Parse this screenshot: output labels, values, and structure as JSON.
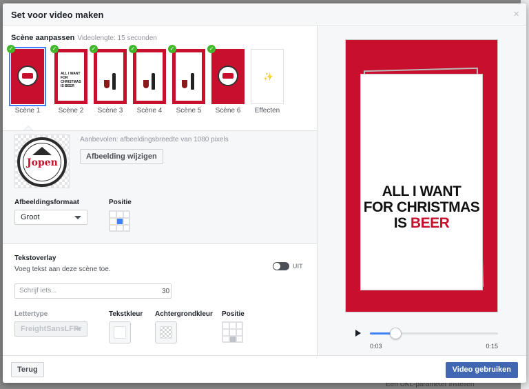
{
  "background": {
    "footer_text": "Een UKL-parameter instellen"
  },
  "dialog": {
    "title": "Set voor video maken",
    "close_glyph": "×"
  },
  "scenes_header": {
    "title": "Scène aanpassen",
    "length_label": "Videolengte: 15 seconden"
  },
  "scenes": [
    {
      "label": "Scène 1",
      "selected": true,
      "checked": true,
      "art": "logo"
    },
    {
      "label": "Scène 2",
      "selected": false,
      "checked": true,
      "art": "text",
      "mini_text": "ALL I WANT FOR CHRISTMAS IS BEER"
    },
    {
      "label": "Scène 3",
      "selected": false,
      "checked": true,
      "art": "glass-bottle"
    },
    {
      "label": "Scène 4",
      "selected": false,
      "checked": true,
      "art": "glass-bottle"
    },
    {
      "label": "Scène 5",
      "selected": false,
      "checked": true,
      "art": "glass-bottle"
    },
    {
      "label": "Scène 6",
      "selected": false,
      "checked": true,
      "art": "logo-red"
    }
  ],
  "effects": {
    "label": "Effecten",
    "icon": "sparkle-icon"
  },
  "image_section": {
    "recommendation": "Aanbevolen: afbeeldingsbreedte van 1080 pixels",
    "change_button": "Afbeelding wijzigen",
    "logo_text": "Jopen",
    "format_label": "Afbeeldingsformaat",
    "format_value": "Groot",
    "position_label": "Positie",
    "position_selected_index": 4
  },
  "text_overlay": {
    "title": "Tekstoverlay",
    "description": "Voeg tekst aan deze scène toe.",
    "toggle_label": "UIT",
    "input_placeholder": "Schrijf iets...",
    "char_limit": "30",
    "font_label": "Lettertype",
    "font_value": "FreightSansLFPr",
    "text_color_label": "Tekstkleur",
    "bg_color_label": "Achtergrondkleur",
    "position_label": "Positie",
    "position_selected_index": 7
  },
  "preview": {
    "line1": "ALL I WANT",
    "line2": "FOR CHRISTMAS",
    "line3_prefix": "IS ",
    "line3_red": "BEER",
    "accent_color": "#c8102e"
  },
  "player": {
    "current_time": "0:03",
    "total_time": "0:15",
    "progress": 0.2
  },
  "footer": {
    "back_button": "Terug",
    "use_button": "Video gebruiken"
  }
}
